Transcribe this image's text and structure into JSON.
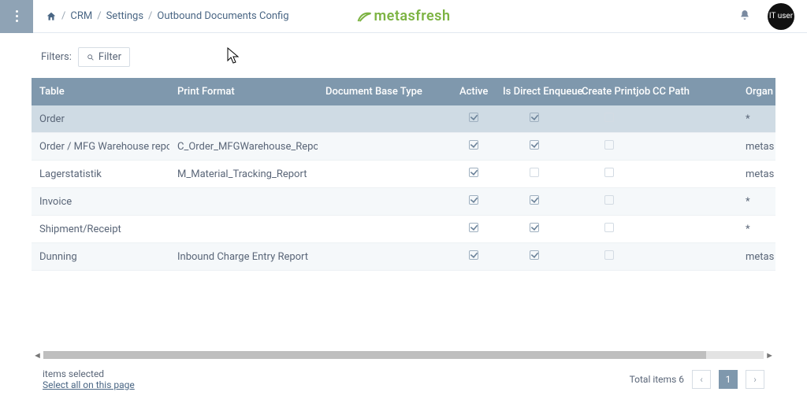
{
  "header": {
    "breadcrumb": [
      "CRM",
      "Settings",
      "Outbound Documents Config"
    ],
    "logo": "metasfresh",
    "avatar": "IT\nuser"
  },
  "filters": {
    "label": "Filters:",
    "button": "Filter"
  },
  "columns": [
    "Table",
    "Print Format",
    "Document Base Type",
    "Active",
    "Is Direct Enqueue",
    "Create Printjob",
    "CC Path",
    "Organisation"
  ],
  "rows": [
    {
      "table": "Order",
      "print_format": "",
      "doc_base_type": "",
      "active": true,
      "direct_enqueue": true,
      "create_printjob": false,
      "cc_path": "",
      "org": "*",
      "selected": true
    },
    {
      "table": "Order / MFG Warehouse report",
      "print_format": "C_Order_MFGWarehouse_Report",
      "doc_base_type": "",
      "active": true,
      "direct_enqueue": true,
      "create_printjob": false,
      "cc_path": "",
      "org": "metas"
    },
    {
      "table": "Lagerstatistik",
      "print_format": "M_Material_Tracking_Report",
      "doc_base_type": "",
      "active": true,
      "direct_enqueue": false,
      "create_printjob": false,
      "cc_path": "",
      "org": "metas"
    },
    {
      "table": "Invoice",
      "print_format": "",
      "doc_base_type": "",
      "active": true,
      "direct_enqueue": true,
      "create_printjob": false,
      "cc_path": "",
      "org": "*"
    },
    {
      "table": "Shipment/Receipt",
      "print_format": "",
      "doc_base_type": "",
      "active": true,
      "direct_enqueue": true,
      "create_printjob": false,
      "cc_path": "",
      "org": "*"
    },
    {
      "table": "Dunning",
      "print_format": "Inbound Charge Entry Report",
      "doc_base_type": "",
      "active": true,
      "direct_enqueue": true,
      "create_printjob": false,
      "cc_path": "",
      "org": "metas"
    }
  ],
  "footer": {
    "items_selected": "items selected",
    "select_all": "Select all on this page",
    "total_label": "Total items",
    "total_count": "6",
    "prev": "‹",
    "page": "1",
    "next": "›"
  }
}
